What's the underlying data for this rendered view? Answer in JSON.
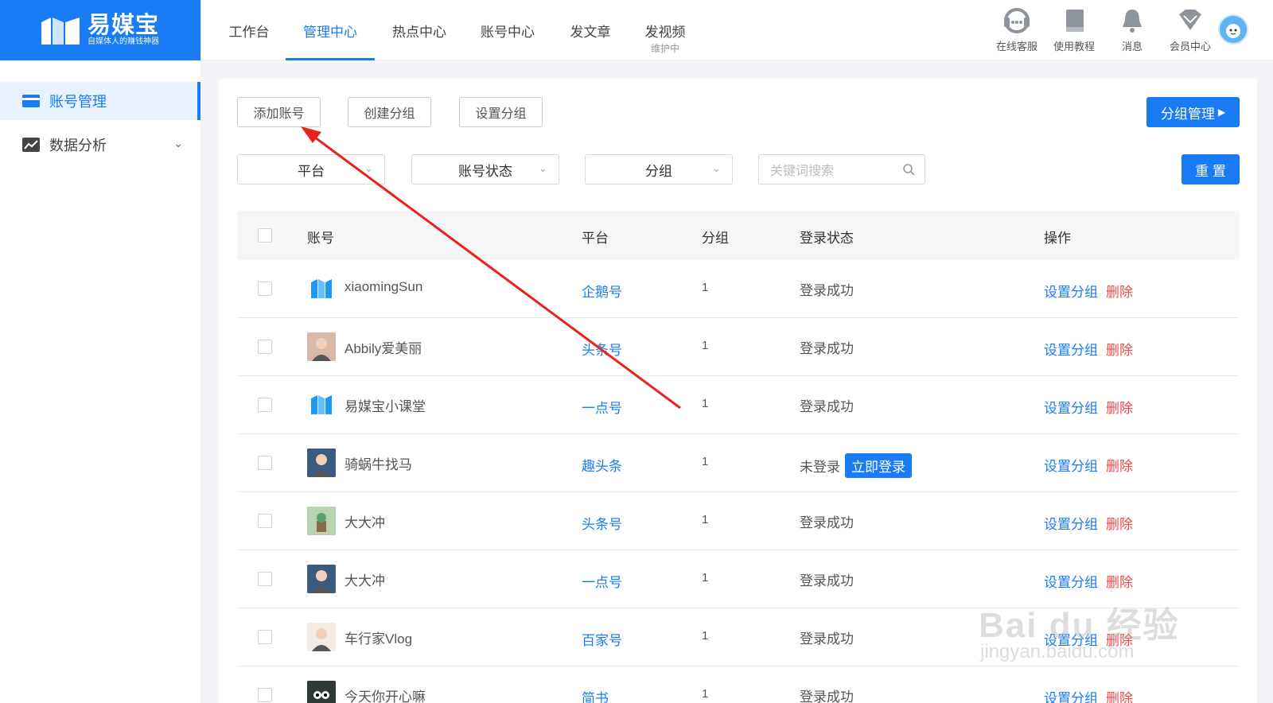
{
  "brand": {
    "name": "易媒宝",
    "slogan": "自媒体人的赚钱神器"
  },
  "nav": [
    {
      "label": "工作台",
      "sub": ""
    },
    {
      "label": "管理中心",
      "sub": ""
    },
    {
      "label": "热点中心",
      "sub": ""
    },
    {
      "label": "账号中心",
      "sub": ""
    },
    {
      "label": "发文章",
      "sub": ""
    },
    {
      "label": "发视频",
      "sub": "维护中"
    }
  ],
  "nav_active": "管理中心",
  "tools": [
    {
      "label": "在线客服",
      "icon": "headset-icon"
    },
    {
      "label": "使用教程",
      "icon": "book-icon"
    },
    {
      "label": "消息",
      "icon": "bell-icon"
    },
    {
      "label": "会员中心",
      "icon": "diamond-icon"
    }
  ],
  "sidebar": {
    "items": [
      {
        "label": "账号管理",
        "icon": "card-icon"
      },
      {
        "label": "数据分析",
        "icon": "chart-icon"
      }
    ]
  },
  "toolbar": {
    "add": "添加账号",
    "create_group": "创建分组",
    "set_group": "设置分组",
    "group_manage": "分组管理"
  },
  "filters": {
    "platform": "平台",
    "status": "账号状态",
    "group": "分组",
    "search_placeholder": "关键词搜索",
    "reset": "重 置"
  },
  "table": {
    "headers": {
      "account": "账号",
      "platform": "平台",
      "group": "分组",
      "login": "登录状态",
      "ops": "操作"
    },
    "rows": [
      {
        "name": "xiaomingSun",
        "platform": "企鹅号",
        "group": "1",
        "status": "登录成功",
        "login_btn": ""
      },
      {
        "name": "Abbily爱美丽",
        "platform": "头条号",
        "group": "1",
        "status": "登录成功",
        "login_btn": ""
      },
      {
        "name": "易媒宝小课堂",
        "platform": "一点号",
        "group": "1",
        "status": "登录成功",
        "login_btn": ""
      },
      {
        "name": "骑蜗牛找马",
        "platform": "趣头条",
        "group": "1",
        "status": "未登录",
        "login_btn": "立即登录"
      },
      {
        "name": "大大冲",
        "platform": "头条号",
        "group": "1",
        "status": "登录成功",
        "login_btn": ""
      },
      {
        "name": "大大冲",
        "platform": "一点号",
        "group": "1",
        "status": "登录成功",
        "login_btn": ""
      },
      {
        "name": "车行家Vlog",
        "platform": "百家号",
        "group": "1",
        "status": "登录成功",
        "login_btn": ""
      },
      {
        "name": "今天你开心嘛_",
        "platform": "简书",
        "group": "1",
        "status": "登录成功",
        "login_btn": ""
      }
    ],
    "ops": {
      "set": "设置分组",
      "del": "删除"
    }
  },
  "watermark": {
    "main": "Bai du 经验",
    "sub": "jingyan.baidu.com"
  },
  "colors": {
    "primary": "#1a7cf5",
    "danger": "#f04a4a",
    "annotation": "#e8231c"
  }
}
